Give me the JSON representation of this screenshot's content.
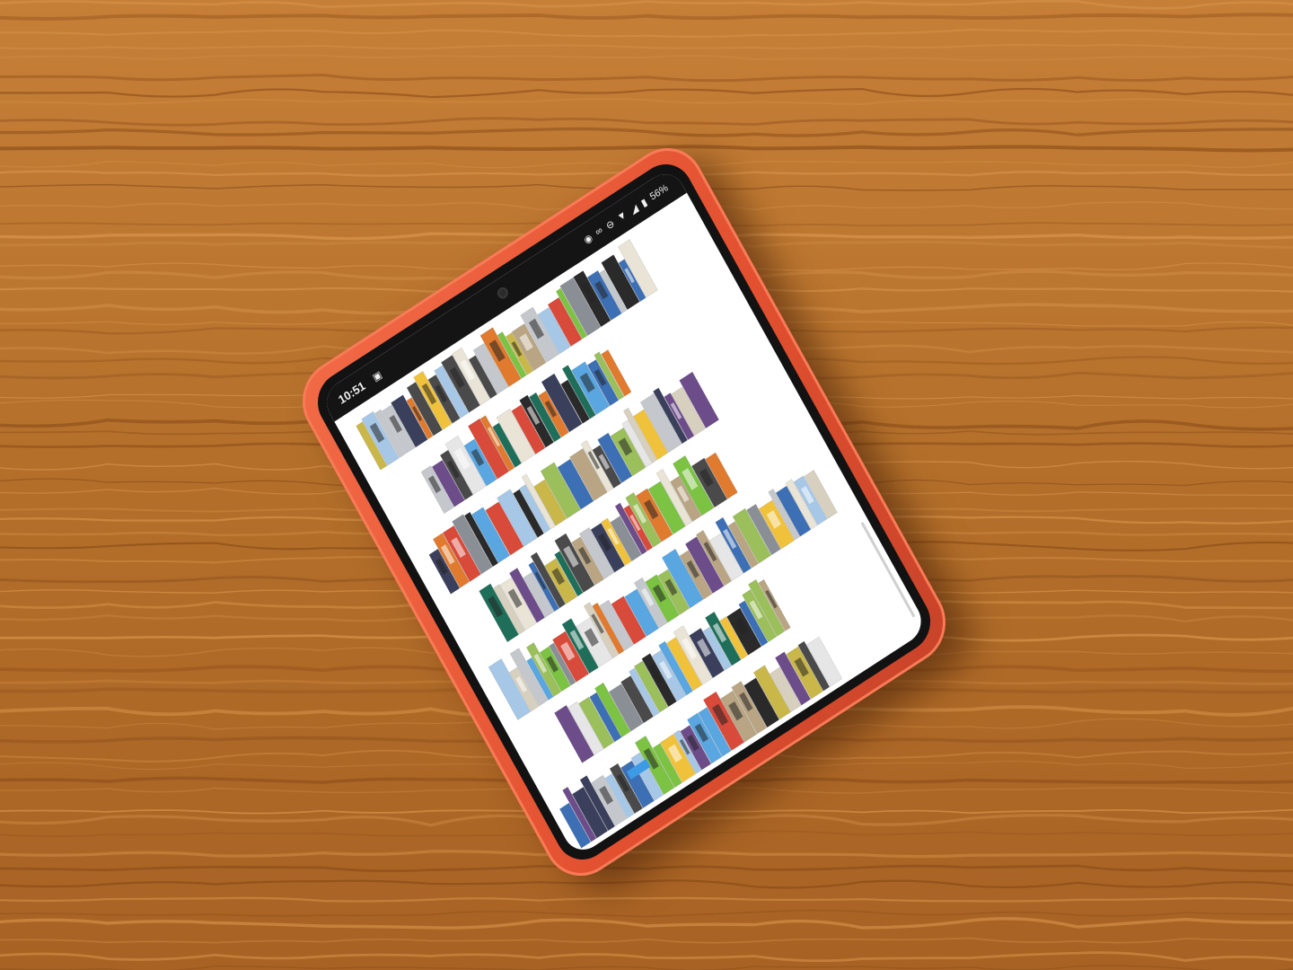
{
  "status_bar": {
    "time": "10:51",
    "battery": "56%",
    "icons": [
      "notification-icon",
      "alarm-icon",
      "vibrate-icon",
      "dnd-icon",
      "wifi-icon",
      "signal-icon",
      "battery-icon"
    ]
  },
  "gallery": {
    "rows": 7,
    "subject": "book-spine photos"
  },
  "colors": {
    "case": "#e8573a",
    "wood": "#b8722c",
    "screen_bg": "#ffffff"
  }
}
